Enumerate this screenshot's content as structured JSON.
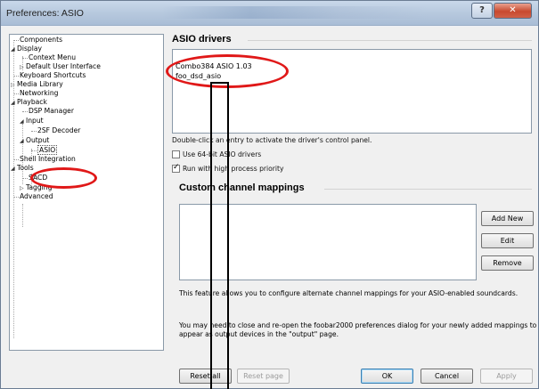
{
  "window": {
    "title": "Preferences: ASIO"
  },
  "titlebar_buttons": {
    "help": "?",
    "close": "✕"
  },
  "tree": {
    "items": [
      {
        "label": "Components"
      },
      {
        "label": "Display",
        "arrow": "◢"
      },
      {
        "label": "Context Menu"
      },
      {
        "label": "Default User Interface",
        "arrow": "▷"
      },
      {
        "label": "Keyboard Shortcuts"
      },
      {
        "label": "Media Library",
        "arrow": "▷"
      },
      {
        "label": "Networking"
      },
      {
        "label": "Playback",
        "arrow": "◢"
      },
      {
        "label": "DSP Manager"
      },
      {
        "label": "Input",
        "arrow": "◢"
      },
      {
        "label": "2SF Decoder"
      },
      {
        "label": "Output",
        "arrow": "◢"
      },
      {
        "label": "ASIO",
        "selected": true
      },
      {
        "label": "Shell Integration"
      },
      {
        "label": "Tools",
        "arrow": "◢"
      },
      {
        "label": "SACD"
      },
      {
        "label": "Tagging",
        "arrow": "▷"
      },
      {
        "label": "Advanced"
      }
    ]
  },
  "asio": {
    "section_title": "ASIO drivers",
    "drivers": [
      "Combo384 ASIO 1.03",
      "foo_dsd_asio"
    ],
    "hint": "Double-click an entry to activate the driver's control panel.",
    "use_64bit_label": "Use 64-bit ASIO drivers",
    "use_64bit_checked": false,
    "high_priority_label": "Run with high process priority",
    "high_priority_checked": true
  },
  "mappings": {
    "section_title": "Custom channel mappings",
    "add_label": "Add New",
    "edit_label": "Edit",
    "remove_label": "Remove",
    "info_1": "This feature allows you to configure alternate channel mappings for your ASIO-enabled soundcards.",
    "info_2": "You may need to close and re-open the foobar2000 preferences dialog for your newly added mappings to appear as output devices in the \"output\" page."
  },
  "footer": {
    "reset_all": "Reset all",
    "reset_page": "Reset page",
    "ok": "OK",
    "cancel": "Cancel",
    "apply": "Apply"
  },
  "colors": {
    "annotation_ring": "#e01818",
    "annotation_bar": "#000000"
  }
}
